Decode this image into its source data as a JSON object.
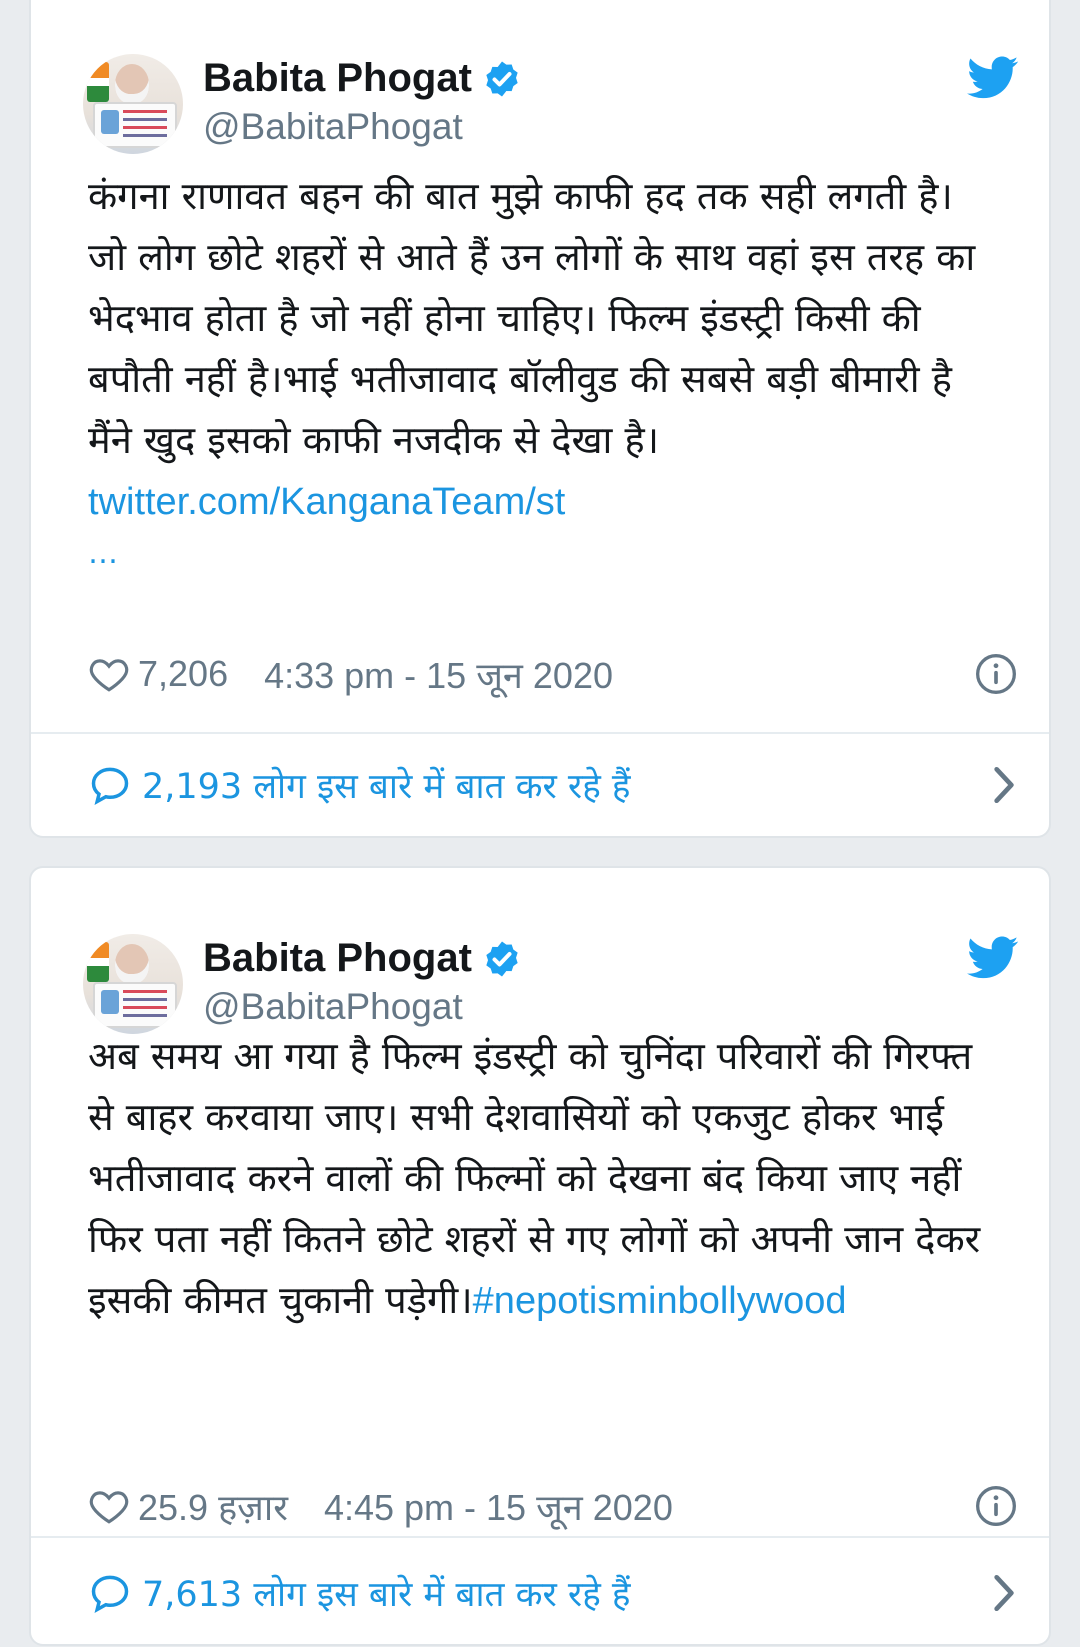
{
  "tweets": [
    {
      "author": {
        "name": "Babita Phogat",
        "handle": "@BabitaPhogat",
        "verified": true
      },
      "text": "कंगना राणावत बहन की बात मुझे काफी हद तक सही लगती है।जो लोग छोटे शहरों से आते हैं उन लोगों के साथ वहां इस तरह का भेदभाव होता है जो नहीं होना चाहिए। फिल्म इंडस्ट्री किसी की बपौती नहीं है।भाई भतीजावाद बॉलीवुड की सबसे बड़ी बीमारी है मैंने खुद इसको काफी नजदीक से देखा है। ",
      "link": "twitter.com/KanganaTeam/st",
      "ellipsis": "…",
      "likes": "7,206",
      "timestamp": "4:33 pm - 15 जून 2020",
      "talking": "2,193 लोग इस बारे में बात कर रहे हैं"
    },
    {
      "author": {
        "name": "Babita Phogat",
        "handle": "@BabitaPhogat",
        "verified": true
      },
      "text": "अब समय आ गया है फिल्म इंडस्ट्री को चुनिंदा परिवारों की गिरफ्त से बाहर करवाया जाए। सभी देशवासियों को एकजुट होकर भाई भतीजावाद करने वालों की फिल्मों को देखना बंद किया जाए नहीं फिर पता नहीं कितने छोटे शहरों से गए लोगों को अपनी जान देकर इसकी कीमत चुकानी पड़ेगी।",
      "hashtag": "#nepotisminbollywood",
      "likes": "25.9 हज़ार",
      "timestamp": "4:45 pm - 15 जून 2020",
      "talking": "7,613 लोग इस बारे में बात कर रहे हैं"
    }
  ],
  "colors": {
    "accent": "#1b95e0",
    "twitter_blue": "#1da1f2",
    "muted": "#657786",
    "text": "#14171a",
    "background": "#e9ecef"
  },
  "icons": [
    "verified-badge-icon",
    "twitter-bird-icon",
    "heart-icon",
    "info-icon",
    "speech-bubble-icon",
    "chevron-right-icon"
  ]
}
